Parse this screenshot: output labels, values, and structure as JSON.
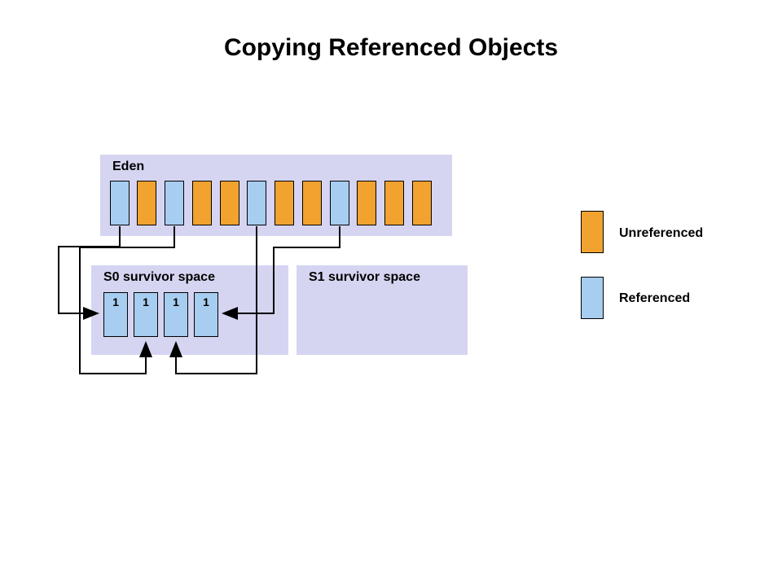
{
  "title": "Copying Referenced Objects",
  "regions": {
    "eden": {
      "label": "Eden"
    },
    "s0": {
      "label": "S0 survivor space"
    },
    "s1": {
      "label": "S1 survivor space"
    }
  },
  "eden_blocks": [
    {
      "type": "referenced"
    },
    {
      "type": "unreferenced"
    },
    {
      "type": "referenced"
    },
    {
      "type": "unreferenced"
    },
    {
      "type": "unreferenced"
    },
    {
      "type": "referenced"
    },
    {
      "type": "unreferenced"
    },
    {
      "type": "unreferenced"
    },
    {
      "type": "referenced"
    },
    {
      "type": "unreferenced"
    },
    {
      "type": "unreferenced"
    },
    {
      "type": "unreferenced"
    }
  ],
  "s0_blocks": [
    {
      "age": "1"
    },
    {
      "age": "1"
    },
    {
      "age": "1"
    },
    {
      "age": "1"
    }
  ],
  "legend": {
    "unreferenced": "Unreferenced",
    "referenced": "Referenced"
  },
  "colors": {
    "region_bg": "#d5d5f2",
    "referenced": "#a7cdf0",
    "unreferenced": "#f2a22e"
  }
}
